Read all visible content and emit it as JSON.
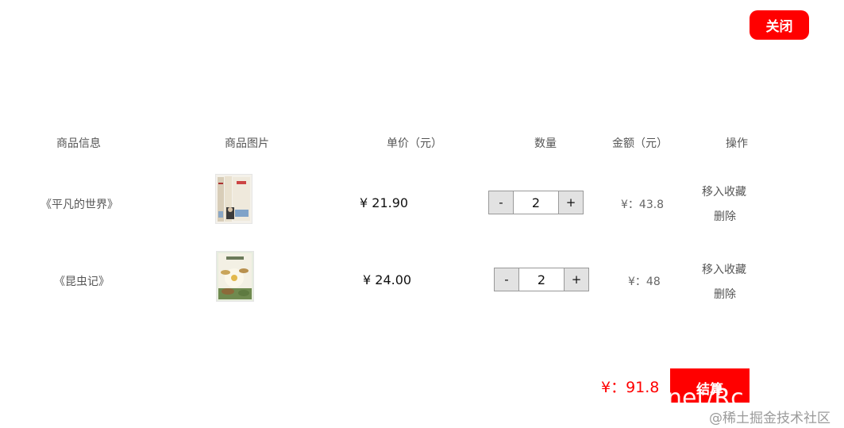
{
  "close_button": {
    "label": "关闭"
  },
  "table": {
    "headers": [
      "商品信息",
      "商品图片",
      "单价（元）",
      "数量",
      "金额（元）",
      "操作"
    ],
    "rows": [
      {
        "title": "《平凡的世界》",
        "price": "¥ 21.90",
        "quantity": "2",
        "amount": "¥：43.8",
        "favorite_label": "移入收藏",
        "delete_label": "删除",
        "minus_label": "-",
        "plus_label": "+"
      },
      {
        "title": "《昆虫记》",
        "price": "¥ 24.00",
        "quantity": "2",
        "amount": "¥：48",
        "favorite_label": "移入收藏",
        "delete_label": "删除",
        "minus_label": "-",
        "plus_label": "+"
      }
    ]
  },
  "footer": {
    "total": "¥：91.8",
    "checkout_label": "结算",
    "checkout_overlay_text": "net/Rc"
  },
  "watermark": "@稀土掘金技术社区",
  "colors": {
    "accent": "#ff0000",
    "stepper_button": "#e2e2e2"
  }
}
